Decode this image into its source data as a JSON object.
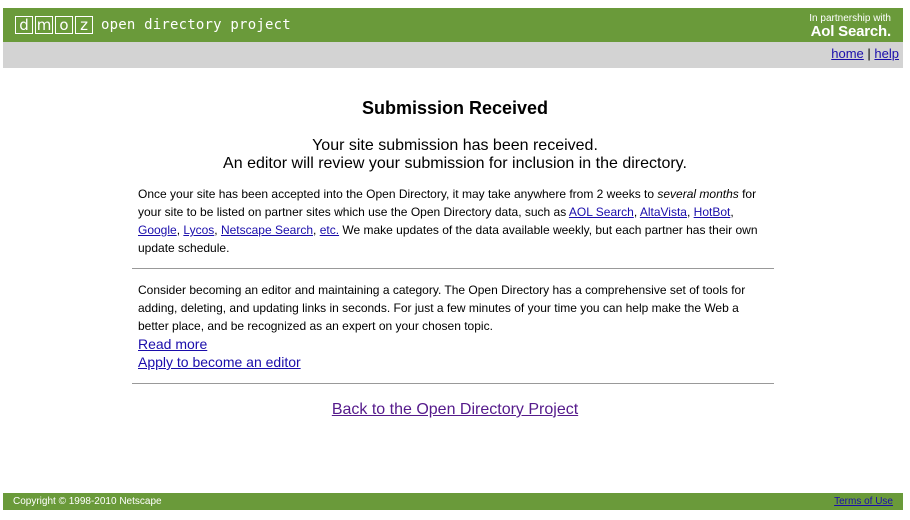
{
  "header": {
    "logo_letters": [
      "d",
      "m",
      "o",
      "z"
    ],
    "tagline": "open directory project",
    "partner_small": "In partnership with",
    "partner_brand": "Aol Search."
  },
  "nav": {
    "home": "home",
    "sep": "|",
    "help": "help"
  },
  "main": {
    "title": "Submission Received",
    "msg_line1": "Your site submission has been received.",
    "msg_line2": "An editor will review your submission for inclusion in the directory.",
    "p1_a": "Once your site has been accepted into the Open Directory, it may take anywhere from 2 weeks to ",
    "p1_em": "several months",
    "p1_b": " for your site to be listed on partner sites which use the Open Directory data, such as ",
    "partners": [
      "AOL Search",
      "AltaVista",
      "HotBot",
      "Google",
      "Lycos",
      "Netscape Search",
      "etc."
    ],
    "p1_c": " We make updates of the data available weekly, but each partner has their own update schedule.",
    "p2": "Consider becoming an editor and maintaining a category. The Open Directory has a comprehensive set of tools for adding, deleting, and updating links in seconds. For just a few minutes of your time you can help make the Web a better place, and be recognized as an expert on your chosen topic.",
    "read_more": "Read more",
    "apply": "Apply to become an editor",
    "back": "Back to the Open Directory Project"
  },
  "footer": {
    "copyright": "Copyright © 1998-2010 Netscape",
    "terms": "Terms of Use"
  }
}
